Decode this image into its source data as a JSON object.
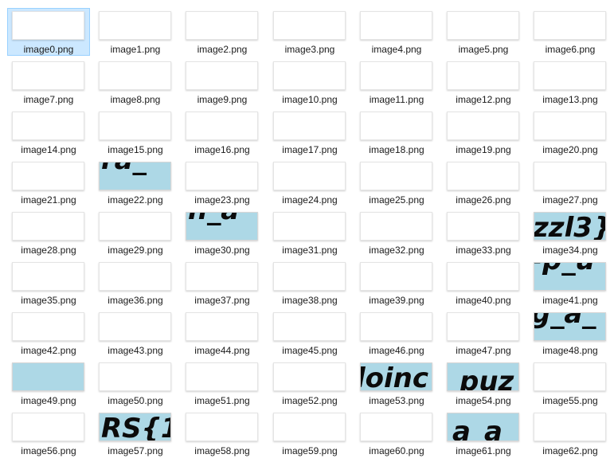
{
  "files": [
    {
      "name": "image0.png",
      "selected": true
    },
    {
      "name": "image1.png"
    },
    {
      "name": "image2.png"
    },
    {
      "name": "image3.png"
    },
    {
      "name": "image4.png"
    },
    {
      "name": "image5.png"
    },
    {
      "name": "image6.png"
    },
    {
      "name": "image7.png"
    },
    {
      "name": "image8.png"
    },
    {
      "name": "image9.png"
    },
    {
      "name": "image10.png"
    },
    {
      "name": "image11.png"
    },
    {
      "name": "image12.png"
    },
    {
      "name": "image13.png"
    },
    {
      "name": "image14.png"
    },
    {
      "name": "image15.png"
    },
    {
      "name": "image16.png"
    },
    {
      "name": "image17.png"
    },
    {
      "name": "image18.png"
    },
    {
      "name": "image19.png"
    },
    {
      "name": "image20.png"
    },
    {
      "name": "image21.png"
    },
    {
      "name": "image22.png",
      "thumb_color": "#add8e6",
      "thumb_text": "ra_"
    },
    {
      "name": "image23.png"
    },
    {
      "name": "image24.png"
    },
    {
      "name": "image25.png"
    },
    {
      "name": "image26.png"
    },
    {
      "name": "image27.png"
    },
    {
      "name": "image28.png"
    },
    {
      "name": "image29.png"
    },
    {
      "name": "image30.png",
      "thumb_color": "#add8e6",
      "thumb_text": "n_a"
    },
    {
      "name": "image31.png"
    },
    {
      "name": "image32.png"
    },
    {
      "name": "image33.png"
    },
    {
      "name": "image34.png",
      "thumb_color": "#add8e6",
      "thumb_text": "zzl3}"
    },
    {
      "name": "image35.png"
    },
    {
      "name": "image36.png"
    },
    {
      "name": "image37.png"
    },
    {
      "name": "image38.png"
    },
    {
      "name": "image39.png"
    },
    {
      "name": "image40.png"
    },
    {
      "name": "image41.png",
      "thumb_color": "#add8e6",
      "thumb_text": "-p_u"
    },
    {
      "name": "image42.png"
    },
    {
      "name": "image43.png"
    },
    {
      "name": "image44.png"
    },
    {
      "name": "image45.png"
    },
    {
      "name": "image46.png"
    },
    {
      "name": "image47.png"
    },
    {
      "name": "image48.png",
      "thumb_color": "#add8e6",
      "thumb_text": "g_a_"
    },
    {
      "name": "image49.png",
      "thumb_color": "#add8e6"
    },
    {
      "name": "image50.png"
    },
    {
      "name": "image51.png"
    },
    {
      "name": "image52.png"
    },
    {
      "name": "image53.png",
      "thumb_color": "#add8e6",
      "thumb_text": "loinc"
    },
    {
      "name": "image54.png",
      "thumb_color": "#add8e6",
      "thumb_text": "_puz"
    },
    {
      "name": "image55.png"
    },
    {
      "name": "image56.png"
    },
    {
      "name": "image57.png",
      "thumb_color": "#add8e6",
      "thumb_text": "RS{1"
    },
    {
      "name": "image58.png"
    },
    {
      "name": "image59.png"
    },
    {
      "name": "image60.png"
    },
    {
      "name": "image61.png",
      "thumb_color": "#add8e6",
      "thumb_text": "a_a"
    },
    {
      "name": "image62.png"
    }
  ],
  "icons": {
    "thumbnail": "image-file-thumbnail-icon"
  },
  "colors": {
    "selection_bg": "#cce8ff",
    "selection_border": "#99d1ff",
    "blank_thumb": "#ffffff",
    "blue_thumb": "#add8e6"
  }
}
